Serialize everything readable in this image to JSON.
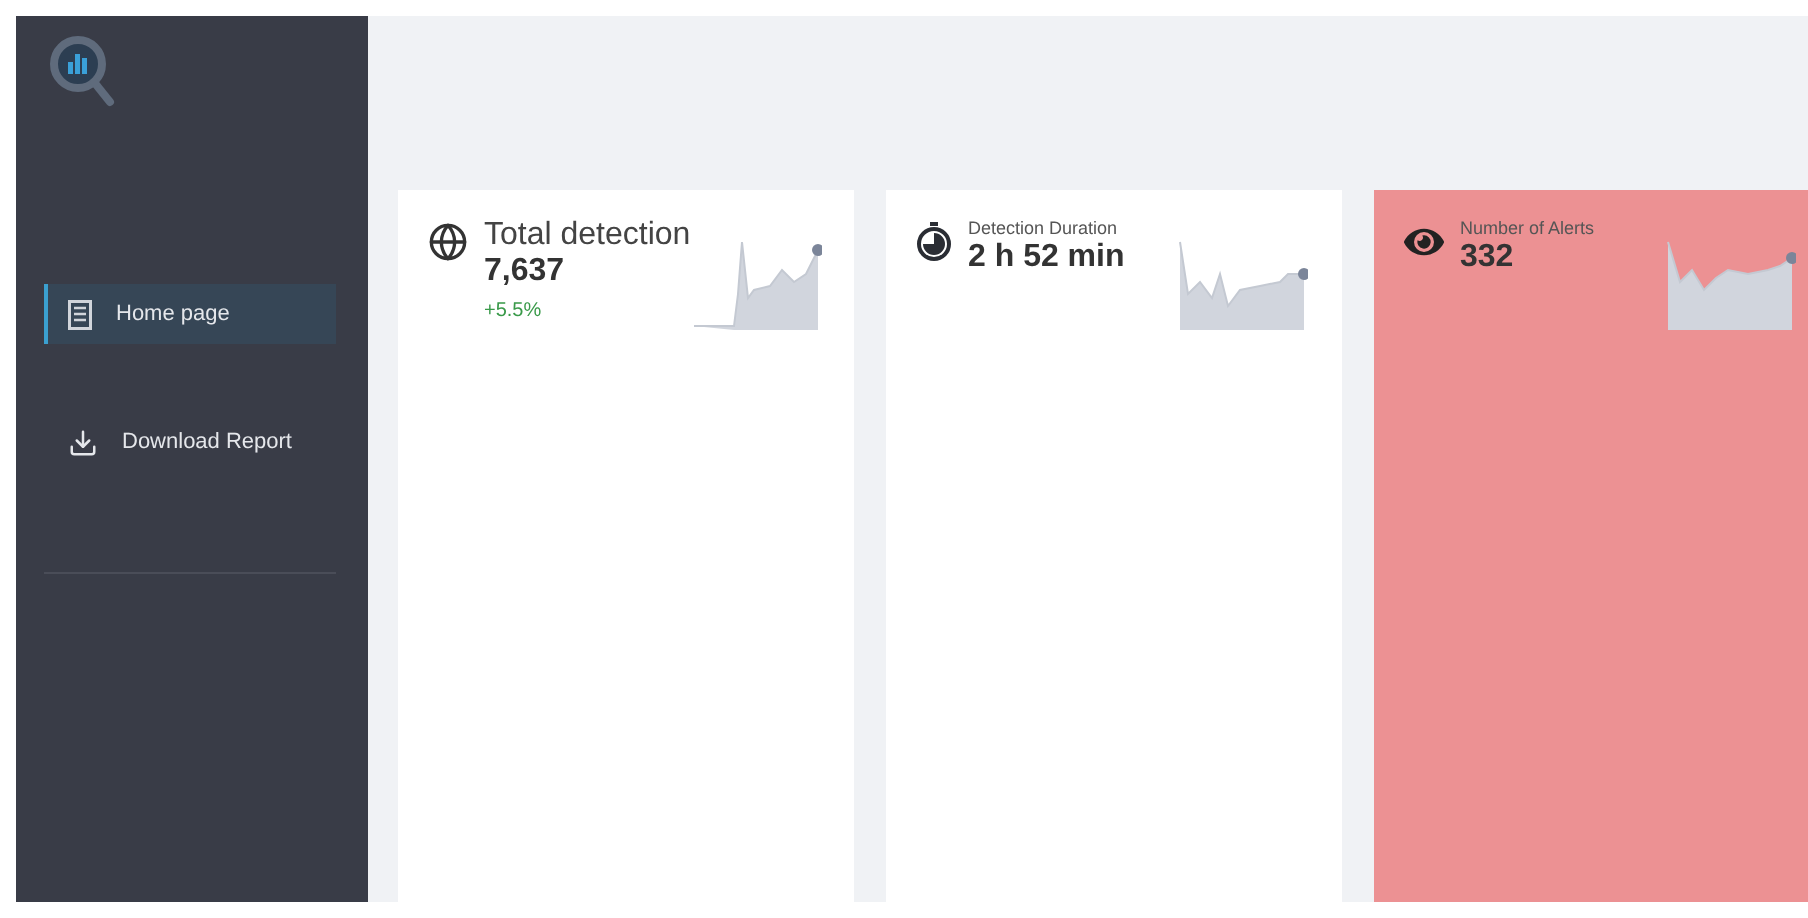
{
  "sidebar": {
    "items": [
      {
        "label": "Home page",
        "selected": true,
        "kind": "list"
      },
      {
        "label": "Download Report",
        "selected": false,
        "kind": "download"
      }
    ]
  },
  "cards": [
    {
      "kind": "large",
      "title": "Total detection",
      "value": "7,637",
      "change": "+5.5%",
      "highlighted": false
    },
    {
      "kind": "small",
      "title": "Detection Duration",
      "value": "2 h 52 min",
      "highlighted": false
    },
    {
      "kind": "small",
      "title": "Number of Alerts",
      "value": "332",
      "highlighted": true
    }
  ]
}
